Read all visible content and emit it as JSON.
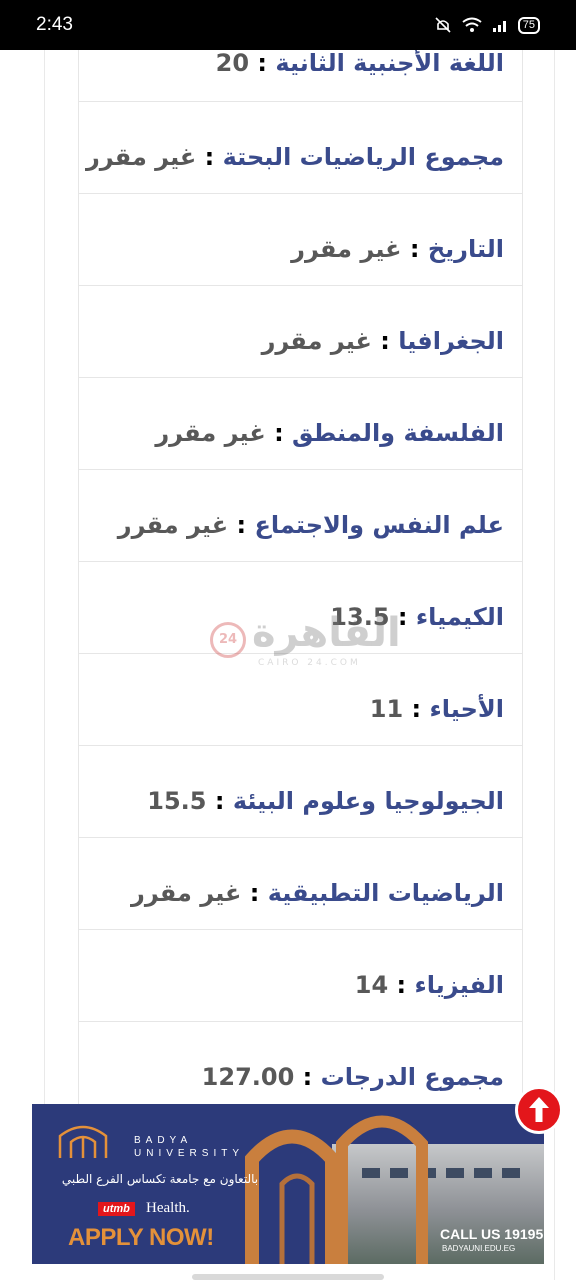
{
  "status_bar": {
    "time": "2:43",
    "battery": "75"
  },
  "results": [
    {
      "label": "اللغة الأجنبية الثانية",
      "value": "20"
    },
    {
      "label": "مجموع الرياضيات البحتة",
      "value": "غير مقرر"
    },
    {
      "label": "التاريخ",
      "value": "غير مقرر"
    },
    {
      "label": "الجغرافيا",
      "value": "غير مقرر"
    },
    {
      "label": "الفلسفة والمنطق",
      "value": "غير مقرر"
    },
    {
      "label": "علم النفس والاجتماع",
      "value": "غير مقرر"
    },
    {
      "label": "الكيمياء",
      "value": "13.5"
    },
    {
      "label": "الأحياء",
      "value": "11"
    },
    {
      "label": "الجيولوجيا وعلوم البيئة",
      "value": "15.5"
    },
    {
      "label": "الرياضيات التطبيقية",
      "value": "غير مقرر"
    },
    {
      "label": "الفيزياء",
      "value": "14"
    },
    {
      "label": "مجموع الدرجات",
      "value": "127.00"
    }
  ],
  "watermark": {
    "badge": "24",
    "word": "القاهرة",
    "sub": "CAIRO 24.COM"
  },
  "ad": {
    "brand_line1": "BADYA",
    "brand_line2": "UNIVERSITY",
    "arabic_text": "بالتعاون مع جامعة تكساس الفرع الطبي",
    "utmb_badge": "utmb",
    "utmb_text": "Health.",
    "apply": "APPLY NOW!",
    "call": "CALL US 19195",
    "website": "BADYAUNI.EDU.EG"
  },
  "colors": {
    "label": "#3a4b8c",
    "value": "#585858",
    "ad_bg": "#2c3a7a",
    "apply": "#e4913a",
    "scroll_top": "#e3161b"
  }
}
